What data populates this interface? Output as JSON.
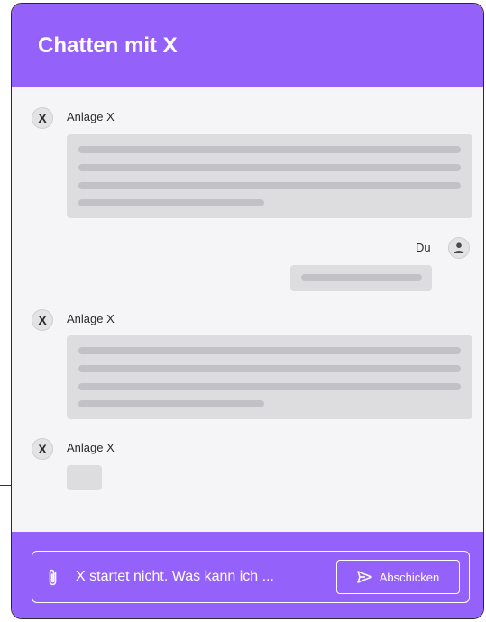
{
  "header": {
    "title": "Chatten mit X"
  },
  "messages": [
    {
      "sender": "Anlage X",
      "avatar_letter": "X",
      "role": "bot"
    },
    {
      "sender": "Du",
      "avatar_icon": "user-icon",
      "role": "user"
    },
    {
      "sender": "Anlage X",
      "avatar_letter": "X",
      "role": "bot"
    },
    {
      "sender": "Anlage X",
      "avatar_letter": "X",
      "role": "bot",
      "typing_indicator": "..."
    }
  ],
  "composer": {
    "value": "X startet nicht. Was kann ich ...",
    "attach_icon": "paperclip-icon",
    "send_label": "Abschicken",
    "send_icon": "send-icon"
  },
  "colors": {
    "accent": "#9561fb",
    "chat_background": "#f5f5f7",
    "bubble": "#dddde0",
    "placeholder_line": "#c2c2c6"
  }
}
